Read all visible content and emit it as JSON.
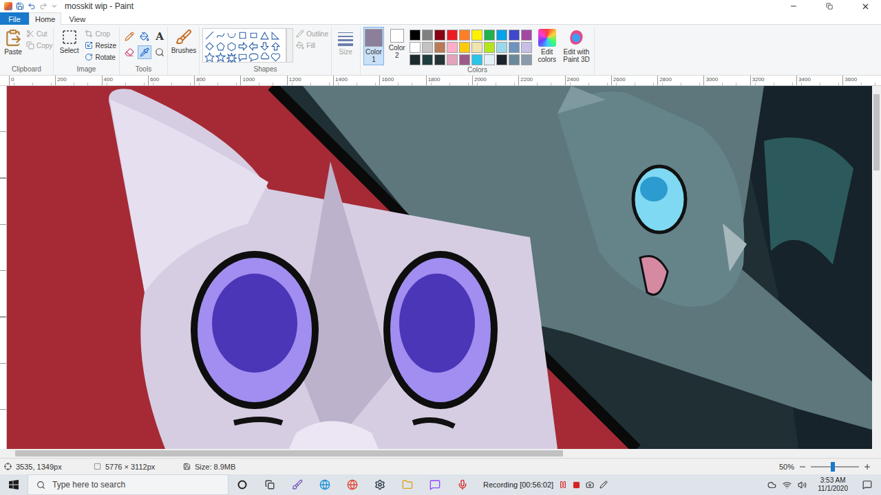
{
  "window": {
    "title": "mosskit wip - Paint"
  },
  "menu_tabs": [
    {
      "label": "File",
      "selected": false,
      "kind": "file"
    },
    {
      "label": "Home",
      "selected": true,
      "kind": "tab"
    },
    {
      "label": "View",
      "selected": false,
      "kind": "tab"
    }
  ],
  "ribbon": {
    "clipboard": {
      "label": "Clipboard",
      "paste": {
        "label": "Paste",
        "disabled": false
      },
      "items": [
        {
          "label": "Cut",
          "disabled": true,
          "kind": "cut"
        },
        {
          "label": "Copy",
          "disabled": true,
          "kind": "copy"
        }
      ]
    },
    "image": {
      "label": "Image",
      "select": {
        "label": "Select"
      },
      "items": [
        {
          "label": "Crop",
          "disabled": true,
          "kind": "crop"
        },
        {
          "label": "Resize",
          "disabled": false,
          "kind": "resize"
        },
        {
          "label": "Rotate",
          "disabled": false,
          "kind": "rotate"
        }
      ]
    },
    "tools": {
      "label": "Tools",
      "items": [
        {
          "kind": "pencil",
          "selected": false
        },
        {
          "kind": "fill",
          "selected": false
        },
        {
          "kind": "text",
          "selected": false,
          "glyph": "A"
        },
        {
          "kind": "eraser",
          "selected": false
        },
        {
          "kind": "picker",
          "selected": true
        },
        {
          "kind": "magnifier",
          "selected": false
        }
      ]
    },
    "brushes": {
      "label": "Brushes"
    },
    "shapes": {
      "label": "Shapes",
      "options": [
        {
          "label": "Outline",
          "disabled": true,
          "kind": "outline"
        },
        {
          "label": "Fill",
          "disabled": true,
          "kind": "fill"
        }
      ]
    },
    "size": {
      "label": "Size",
      "disabled": true
    },
    "colors": {
      "label": "Colors",
      "color1": {
        "label": "Color 1",
        "color": "#8b7f9c",
        "selected": true
      },
      "color2": {
        "label": "Color 2",
        "color": "#ffffff",
        "selected": false
      },
      "palette": [
        {
          "color": "#000000"
        },
        {
          "color": "#7f7f7f"
        },
        {
          "color": "#880015"
        },
        {
          "color": "#ed1c24"
        },
        {
          "color": "#ff7f27"
        },
        {
          "color": "#fff200"
        },
        {
          "color": "#22b14c"
        },
        {
          "color": "#00a2e8"
        },
        {
          "color": "#3f48cc"
        },
        {
          "color": "#a349a4"
        },
        {
          "color": "#ffffff"
        },
        {
          "color": "#c3c3c3"
        },
        {
          "color": "#b97a57"
        },
        {
          "color": "#ffaec9"
        },
        {
          "color": "#ffc90e"
        },
        {
          "color": "#efe4b0"
        },
        {
          "color": "#b5e61d"
        },
        {
          "color": "#99d9ea"
        },
        {
          "color": "#7092be"
        },
        {
          "color": "#c8bfe7"
        },
        {
          "color": "#1d2b2e"
        },
        {
          "color": "#1f3d3d"
        },
        {
          "color": "#263435"
        },
        {
          "color": "#e4a3bd"
        },
        {
          "color": "#9b5a8a"
        },
        {
          "color": "#2cc3e6"
        },
        {
          "color": "#e2f1f8"
        },
        {
          "color": "#1c232b"
        },
        {
          "color": "#6b8999"
        },
        {
          "color": "#8a9bac"
        }
      ],
      "edit_colors": {
        "label": "Edit colors"
      },
      "paint3d": {
        "label": "Edit with Paint 3D"
      }
    }
  },
  "ruler": [
    "0",
    "200",
    "400",
    "600",
    "800",
    "1000",
    "1200",
    "1400",
    "1600",
    "1800",
    "2000",
    "2200",
    "2400",
    "2600",
    "2800",
    "3000",
    "3200",
    "3400",
    "3600"
  ],
  "scrollbars": {
    "horizontal": {
      "level": 0.64
    },
    "vertical": {
      "level": 0.22
    }
  },
  "status_bar": {
    "cursor": "3535, 1349px",
    "dimensions": "5776 × 3112px",
    "size": "Size: 8.9MB",
    "zoom": "50%",
    "zoom_level": 0.45
  },
  "taskbar": {
    "search_placeholder": "Type here to search",
    "recording": {
      "label": "Recording [00:56:02]"
    },
    "clock": {
      "time": "3:53 AM",
      "date": "11/1/2020"
    }
  }
}
